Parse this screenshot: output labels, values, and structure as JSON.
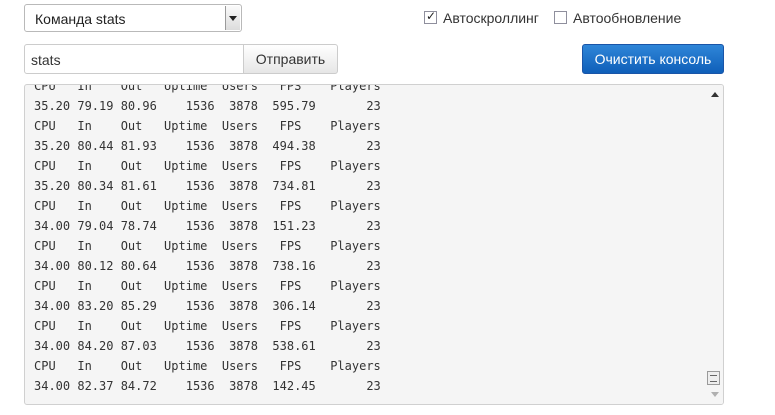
{
  "command_select": {
    "value": "Команда stats"
  },
  "autoscroll": {
    "label": "Автоскроллинг",
    "checked": true
  },
  "autorefresh": {
    "label": "Автообновление",
    "checked": false
  },
  "command_input": {
    "value": "stats"
  },
  "send_button": {
    "label": "Отправить"
  },
  "clear_button": {
    "label": "Очистить консоль"
  },
  "console": {
    "lines": [
      "CPU   In    Out   Uptime  Users   FPS    Players",
      "35.20 79.19 80.96    1536  3878  595.79       23",
      "CPU   In    Out   Uptime  Users   FPS    Players",
      "35.20 80.44 81.93    1536  3878  494.38       23",
      "CPU   In    Out   Uptime  Users   FPS    Players",
      "35.20 80.34 81.61    1536  3878  734.81       23",
      "CPU   In    Out   Uptime  Users   FPS    Players",
      "34.00 79.04 78.74    1536  3878  151.23       23",
      "CPU   In    Out   Uptime  Users   FPS    Players",
      "34.00 80.12 80.64    1536  3878  738.16       23",
      "CPU   In    Out   Uptime  Users   FPS    Players",
      "34.00 83.20 85.29    1536  3878  306.14       23",
      "CPU   In    Out   Uptime  Users   FPS    Players",
      "34.00 84.20 87.03    1536  3878  538.61       23",
      "CPU   In    Out   Uptime  Users   FPS    Players",
      "34.00 82.37 84.72    1536  3878  142.45       23"
    ]
  },
  "colors": {
    "primary_button": "#1565c0",
    "console_bg": "#f5f5f5"
  }
}
